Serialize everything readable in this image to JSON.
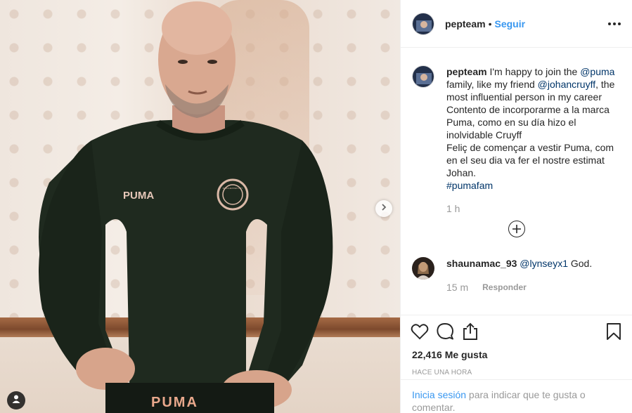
{
  "post": {
    "username": "pepteam",
    "follow_label": "Seguir",
    "separator": "•",
    "caption": {
      "username": "pepteam",
      "line1": " I'm happy to join the ",
      "mention1": "@puma",
      "line2": " family, like my friend ",
      "mention2": "@johancruyff",
      "line3": ", the most influential person in my career",
      "es": "Contento de incorporarme a la marca Puma, como en su día hizo el inolvidable Cruyff",
      "ca": "Feliç de començar a vestir Puma, com en el seu dia va fer el nostre estimat Johan.",
      "hashtag": "#pumafam",
      "time": "1 h"
    },
    "comment": {
      "username": "shaunamac_93",
      "mention": "@lynseyx1",
      "text": " God.",
      "time": "15 m",
      "reply_label": "Responder"
    },
    "likes": "22,416 Me gusta",
    "posted_ago": "Hace una hora",
    "login": {
      "link": "Inicia sesión",
      "rest": " para indicar que te gusta o comentar."
    }
  },
  "photo": {
    "shirt_brand": "PUMA",
    "badge_text": "MANCHESTER CITY",
    "waistband_text": "PUMA"
  },
  "icons": [
    "chevron-right-icon",
    "tag-user-icon",
    "more-options-icon",
    "heart-icon",
    "comment-icon",
    "share-icon",
    "bookmark-icon",
    "plus-circle-icon"
  ],
  "colors": {
    "link_blue": "#3897f0",
    "mention_blue": "#003569",
    "text": "#262626",
    "muted": "#999999",
    "border": "#efefef"
  }
}
